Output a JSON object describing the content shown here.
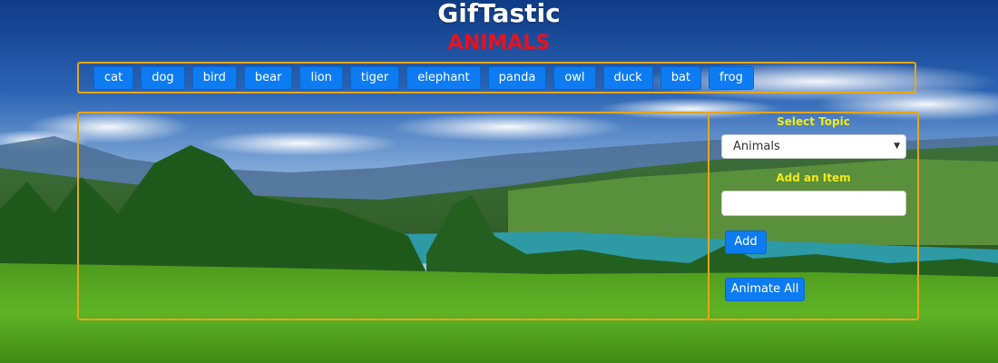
{
  "header": {
    "title": "GifTastic",
    "subtitle": "ANIMALS"
  },
  "topics": [
    "cat",
    "dog",
    "bird",
    "bear",
    "lion",
    "tiger",
    "elephant",
    "panda",
    "owl",
    "duck",
    "bat",
    "frog"
  ],
  "side_panel": {
    "select_label": "Select Topic",
    "select_value": "Animals",
    "add_label": "Add an Item",
    "input_value": "",
    "add_button": "Add",
    "animate_button": "Animate All"
  },
  "colors": {
    "accent_border": "#e6a516",
    "button_blue": "#0d7cf2",
    "subtitle_red": "#e8121f",
    "label_yellow": "#f2ea1a"
  }
}
